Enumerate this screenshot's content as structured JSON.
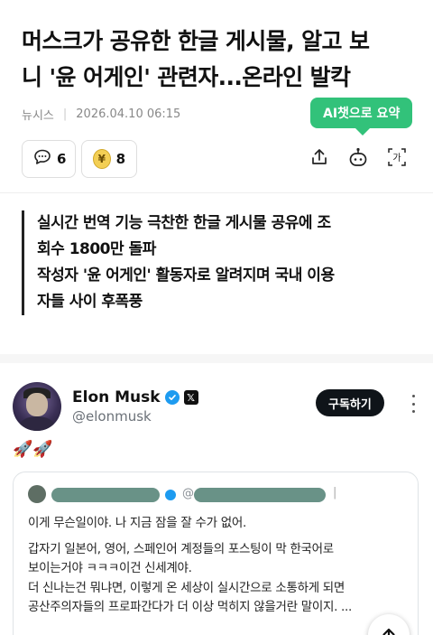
{
  "article": {
    "title_line1": "머스크가 공유한 한글 게시물, 알고 보",
    "title_line2": "니 '윤 어게인' 관련자...온라인 발칵",
    "source": "뉴시스",
    "date": "2026.04.10 06:15"
  },
  "ai_summary": {
    "label": "AI챗으로 요약"
  },
  "reactions": {
    "comment_count": "6",
    "coin_symbol": "¥",
    "coin_count": "8"
  },
  "toolbar": {
    "share_icon": "share-icon",
    "bot_icon": "chatbot-icon",
    "font_label": "가"
  },
  "summary": {
    "line1": "실시간 번역 기능 극찬한 한글 게시물 공유에 조",
    "line2": "회수 1800만 돌파",
    "line3": "작성자 '윤 어게인' 활동자로 알려지며 국내 이용",
    "line4": "자들 사이 후폭풍"
  },
  "embed": {
    "author_name": "Elon Musk",
    "handle": "@elonmusk",
    "subscribe_label": "구독하기",
    "tweet_text": "🚀🚀",
    "quote": {
      "handle_prefix": "@",
      "separator": "|",
      "line1": "이게 무슨일이야. 나 지금 잠을 잘 수가 없어.",
      "line2": "갑자기 일본어, 영어, 스페인어 계정들의 포스팅이 막 한국어로",
      "line3": "보이는거야 ㅋㅋㅋ이건 신세계야.",
      "line4": "더 신나는건 뭐냐면, 이렇게 온 세상이 실시간으로 소통하게 되면",
      "line5": "공산주의자들의 프로파간다가 더 이상 먹히지 않을거란 말이지. ..."
    }
  },
  "colors": {
    "ai_badge": "#32c27a",
    "verified": "#1d9bf0",
    "subscribe_bg": "#0f1419",
    "blur_mask": "#4f7f72"
  }
}
